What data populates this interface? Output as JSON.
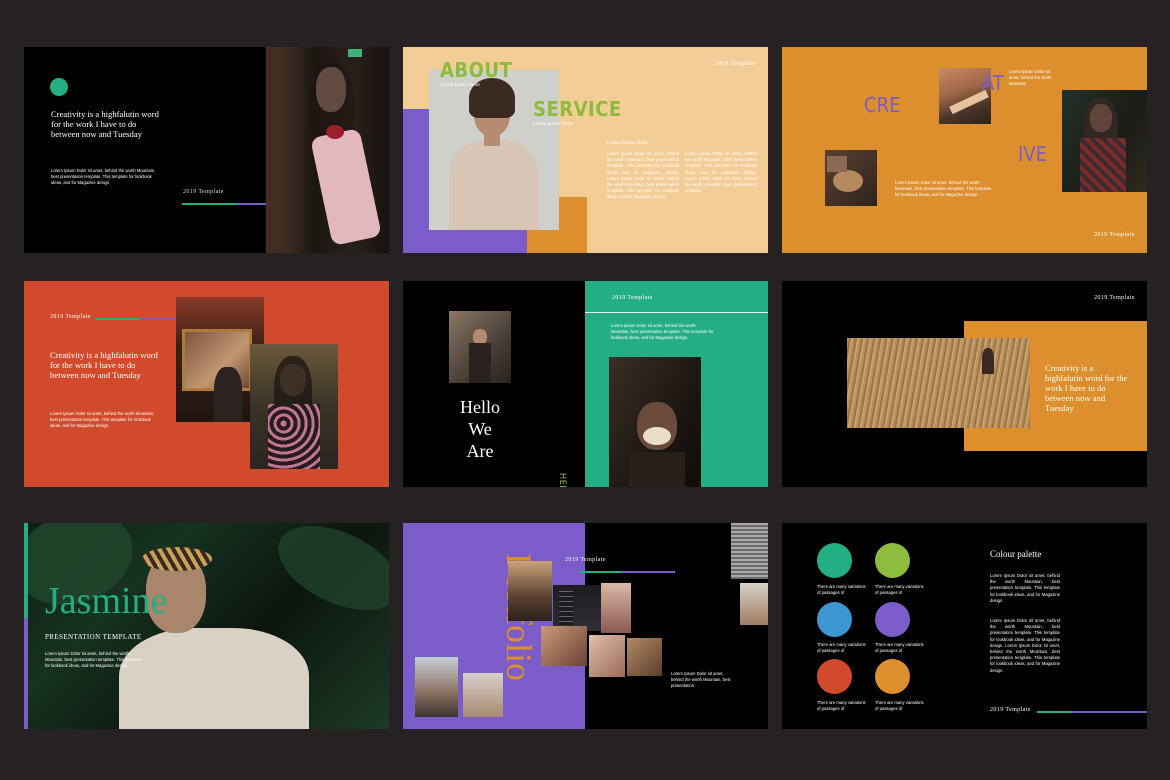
{
  "colors": {
    "background": "#262223",
    "black": "#000000",
    "green": "#24ae84",
    "purple": "#7c5cc8",
    "peach": "#f3cd96",
    "orange": "#dc8f2c",
    "rust": "#d14a2b",
    "lime": "#8dbb3c",
    "blue": "#3e96d2",
    "cream": "#e9d8a8"
  },
  "slide1": {
    "headline": "Creativity is a highfalutin word for the work I have to do between now and Tuesday",
    "body": "Lorem Ipsum Dolor sit amet, behind the worth Mountain, best presentation template. This template for lookbook ideas, and for Magazine design.",
    "template_label": "2019 Template"
  },
  "slide2": {
    "about": "ABOUT",
    "about_sub": "Lorem Ipsum Dolor",
    "service": "SERVICE",
    "service_sub": "Lorem Ipsum Dolor",
    "template_label": "2019 Template",
    "col1_title": "Lorem Ipsum Dolor",
    "col1_text": "Lorem ipsum Dolor sit amet, behind the worth Mountain, best presentation template. This template for lookbook ideas, and for Magazine design. Lorem ipsum dolor sit amet, behind the worth mountain, best presentation template. This template for lookbook ideas, and for Magazine design.",
    "col2_text": "Lorem ipsum Dolor sit amet, behind the worth Mountain, best presentation template. This template for lookbook ideas, and for Magazine design. Lorem ipsum dolor sit amet, behind the worth mountain, best presentation template."
  },
  "slide3": {
    "cre": "CRE",
    "at": "AT",
    "ive": "IVE",
    "text_top": "Lorem Ipsum Dolor sit amet, behind the worth Mountain",
    "text_bottom": "Lorem Ipsum Dolor sit amet, behind the worth Mountain, best presentation template. This template for lookbook ideas, and for Magazine design.",
    "template_label": "2019 Template"
  },
  "slide4": {
    "template_label": "2019 Template",
    "headline": "Creativity is a highfalutin word for the work I have to do between now and Tuesday",
    "body": "Lorem Ipsum Dolor sit amet, behind the worth Mountain, best presentation template. This template for lookbook ideas, and for Magazine design."
  },
  "slide5": {
    "template_label": "2019 Template",
    "body": "Lorem Ipsum Dolor sit amet, behind the worth Mountain, best presentation template. This template for lookbook ideas, and for Magazine design.",
    "hello_lines": [
      "Hello",
      "We",
      "Are"
    ],
    "vertical_text": "HELLO WELCOME NEW TEMPLATE"
  },
  "slide6": {
    "template_label": "2019 Template",
    "headline": "Creativity is a highfalutin word for the work I have to do between now and Tuesday"
  },
  "slide7": {
    "name": "Jasmine",
    "subtitle": "PRESENTATION TEMPLATE",
    "body": "Lorem Ipsum Dolor sit amet, behind the worth Mountain, best presentation template. This template for lookbook ideas, and for Magazine design."
  },
  "slide8": {
    "title": "Portfolio",
    "template_label": "2019 Template",
    "body": "Lorem Ipsum Dolor sit amet, behind the worth Mountain, best presentation"
  },
  "slide9": {
    "title": "Colour palette",
    "text1": "Lorem Ipsum Dolor sit amet, behind the worth Mountain, best presentation template. This template for lookbook ideas, and for Magazine design.",
    "text2": "Lorem Ipsum Dolor sit amet, behind the worth Mountain, best presentation template. This template for lookbook ideas, and for Magazine design. Lorem Ipsum Dolor sit amet, behind the worth Mountain, best presentation template. This template for lookbook ideas, and for Magazine design.",
    "swatch_caption": "There are many variations of passages of",
    "template_label": "2019 Template"
  }
}
